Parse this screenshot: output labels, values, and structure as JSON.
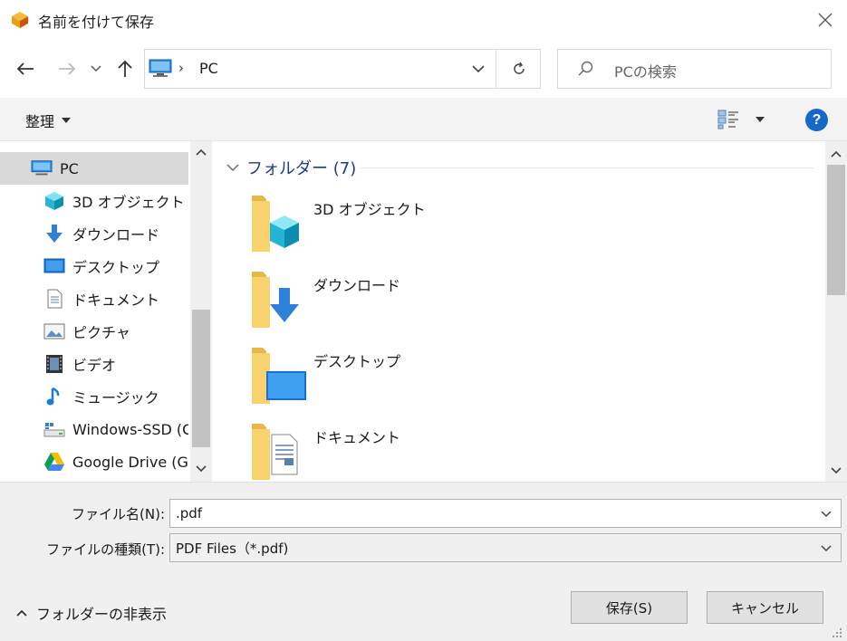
{
  "window": {
    "title": "名前を付けて保存"
  },
  "address": {
    "location": "PC"
  },
  "search": {
    "placeholder": "PCの検索"
  },
  "toolbar": {
    "organize_label": "整理"
  },
  "nav": {
    "items": [
      {
        "label": "PC",
        "icon": "pc-icon"
      },
      {
        "label": "3D オブジェクト",
        "icon": "3d-objects-icon"
      },
      {
        "label": "ダウンロード",
        "icon": "download-icon"
      },
      {
        "label": "デスクトップ",
        "icon": "desktop-icon"
      },
      {
        "label": "ドキュメント",
        "icon": "document-icon"
      },
      {
        "label": "ピクチャ",
        "icon": "pictures-icon"
      },
      {
        "label": "ビデオ",
        "icon": "video-icon"
      },
      {
        "label": "ミュージック",
        "icon": "music-icon"
      },
      {
        "label": "Windows-SSD (C",
        "icon": "drive-icon"
      },
      {
        "label": "Google Drive (G:",
        "icon": "google-drive-icon"
      }
    ]
  },
  "content": {
    "group_title": "フォルダー (7)",
    "folders": [
      {
        "label": "3D オブジェクト",
        "icon": "3d-objects-folder-icon"
      },
      {
        "label": "ダウンロード",
        "icon": "downloads-folder-icon"
      },
      {
        "label": "デスクトップ",
        "icon": "desktop-folder-icon"
      },
      {
        "label": "ドキュメント",
        "icon": "documents-folder-icon"
      }
    ]
  },
  "form": {
    "filename_label": "ファイル名(N):",
    "filename_value": ".pdf",
    "filetype_label": "ファイルの種類(T):",
    "filetype_value": "PDF Files（*.pdf)"
  },
  "footer": {
    "hide_folders_label": "フォルダーの非表示",
    "save_label": "保存(S)",
    "cancel_label": "キャンセル"
  },
  "colors": {
    "accent": "#1568c8",
    "group_header": "#1e3a8a",
    "folder_yellow": "#f7d26e"
  }
}
